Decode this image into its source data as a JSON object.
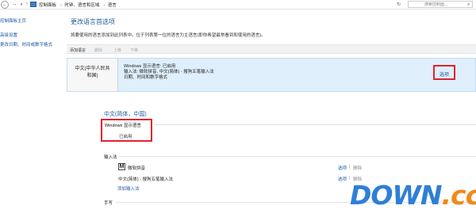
{
  "address_bar": {
    "breadcrumbs": [
      "控制面板",
      "时钟、语言和区域",
      "语言"
    ],
    "search_placeholder": "搜索控制面..."
  },
  "left_nav": {
    "items": [
      "控制面板主页",
      "高级设置",
      "更改日期、时间或数字格式"
    ]
  },
  "main": {
    "title": "更改语言首选项",
    "description": "将要使用的语言添加到此列表中。位于列表第一位的语言为主语言(即你希望最常看到和使用的语言)。",
    "toolbar": {
      "add": "添加语言",
      "delete": "删除",
      "up": "上移",
      "down": "下移"
    },
    "language_row": {
      "name_line1": "中文(中华人民共",
      "name_line2": "和国)",
      "info_line1": "Windows 显示语言: 已启用",
      "info_line2": "输入法: 微软拼音, 中文(简体) - 搜狗五笔输入法",
      "info_line3": "日期、时间和数字格式",
      "options": "选项"
    }
  },
  "detail": {
    "heading": "中文(简体，中国)",
    "windows_display_label": "Windows 显示语言",
    "windows_display_status": "已启用",
    "ime_label": "输入法",
    "ime_items": [
      {
        "icon": "M",
        "name": "微软拼音",
        "options": "选项",
        "sep": "|",
        "delete": "删除"
      },
      {
        "name": "中文(简体) - 搜狗五笔输入法",
        "options": "选项",
        "sep": "|",
        "delete": "删除"
      }
    ],
    "add_ime": "添加输入法",
    "handwriting_label": "手写"
  },
  "watermark": {
    "text": "DOWN",
    "dot": ".",
    "suffix": "cc"
  },
  "colors": {
    "link": "#1a56a0",
    "heading": "#1e5c9b",
    "highlight": "#e2222f",
    "selected_row": "#dfeffc"
  }
}
